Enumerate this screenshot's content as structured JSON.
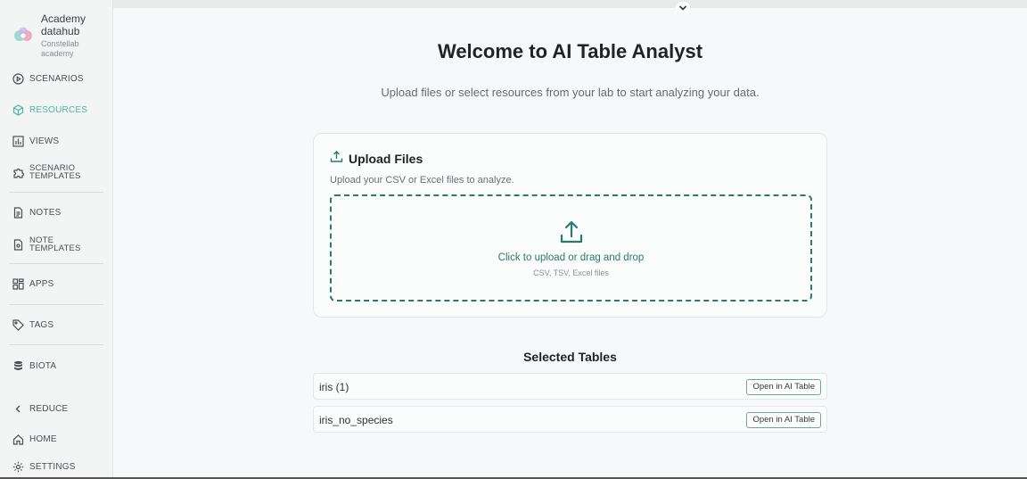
{
  "brand": {
    "name": "Academy datahub",
    "subtitle": "Constellab academy"
  },
  "sidebar": {
    "items": [
      {
        "label": "SCENARIOS",
        "icon": "play-circle-icon"
      },
      {
        "label": "RESOURCES",
        "icon": "cube-icon",
        "active": true
      },
      {
        "label": "VIEWS",
        "icon": "bar-chart-icon"
      },
      {
        "label": "SCENARIO TEMPLATES",
        "icon": "puzzle-icon"
      },
      {
        "label": "NOTES",
        "icon": "document-icon"
      },
      {
        "label": "NOTE TEMPLATES",
        "icon": "template-doc-icon"
      },
      {
        "label": "APPS",
        "icon": "grid-icon"
      },
      {
        "label": "TAGS",
        "icon": "tag-icon"
      },
      {
        "label": "BIOTA",
        "icon": "database-icon"
      },
      {
        "label": "REDUCE",
        "icon": "chevron-left-icon"
      },
      {
        "label": "HOME",
        "icon": "home-icon"
      },
      {
        "label": "SETTINGS",
        "icon": "gear-icon"
      }
    ]
  },
  "main": {
    "title": "Welcome to AI Table Analyst",
    "subtitle": "Upload files or select resources from your lab to start analyzing your data.",
    "upload": {
      "title": "Upload Files",
      "description": "Upload your CSV or Excel files to analyze.",
      "dropzone_main": "Click to upload or drag and drop",
      "dropzone_sub": "CSV, TSV, Excel files"
    },
    "selected": {
      "title": "Selected Tables",
      "rows": [
        {
          "name": "iris (1)",
          "action": "Open in AI Table"
        },
        {
          "name": "iris_no_species",
          "action": "Open in AI Table"
        }
      ]
    }
  },
  "colors": {
    "accent": "#2c7a6a",
    "active_nav": "#4cb6a3"
  }
}
